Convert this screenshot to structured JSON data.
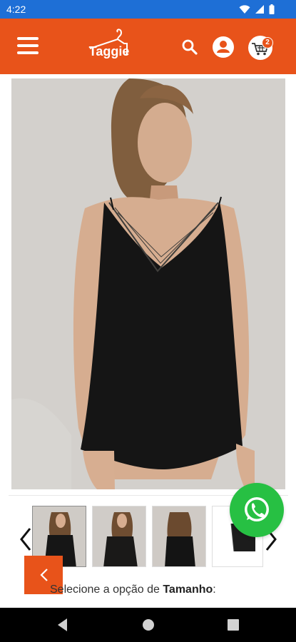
{
  "status_bar": {
    "time": "4:22",
    "icons": [
      "wifi-icon",
      "signal-icon",
      "battery-icon"
    ]
  },
  "header": {
    "logo_text": "Taggie",
    "icons": [
      "menu-icon",
      "search-icon",
      "user-icon",
      "cart-icon"
    ],
    "cart_count": "2"
  },
  "product": {
    "thumbnails_count": 4,
    "size_prompt_prefix": "Selecione a opção de ",
    "size_prompt_option": "Tamanho",
    "size_prompt_suffix": ":"
  },
  "colors": {
    "header": "#e8531a",
    "status_bar": "#1e6fd6",
    "whatsapp": "#27c043",
    "nav_bar": "#000000"
  }
}
